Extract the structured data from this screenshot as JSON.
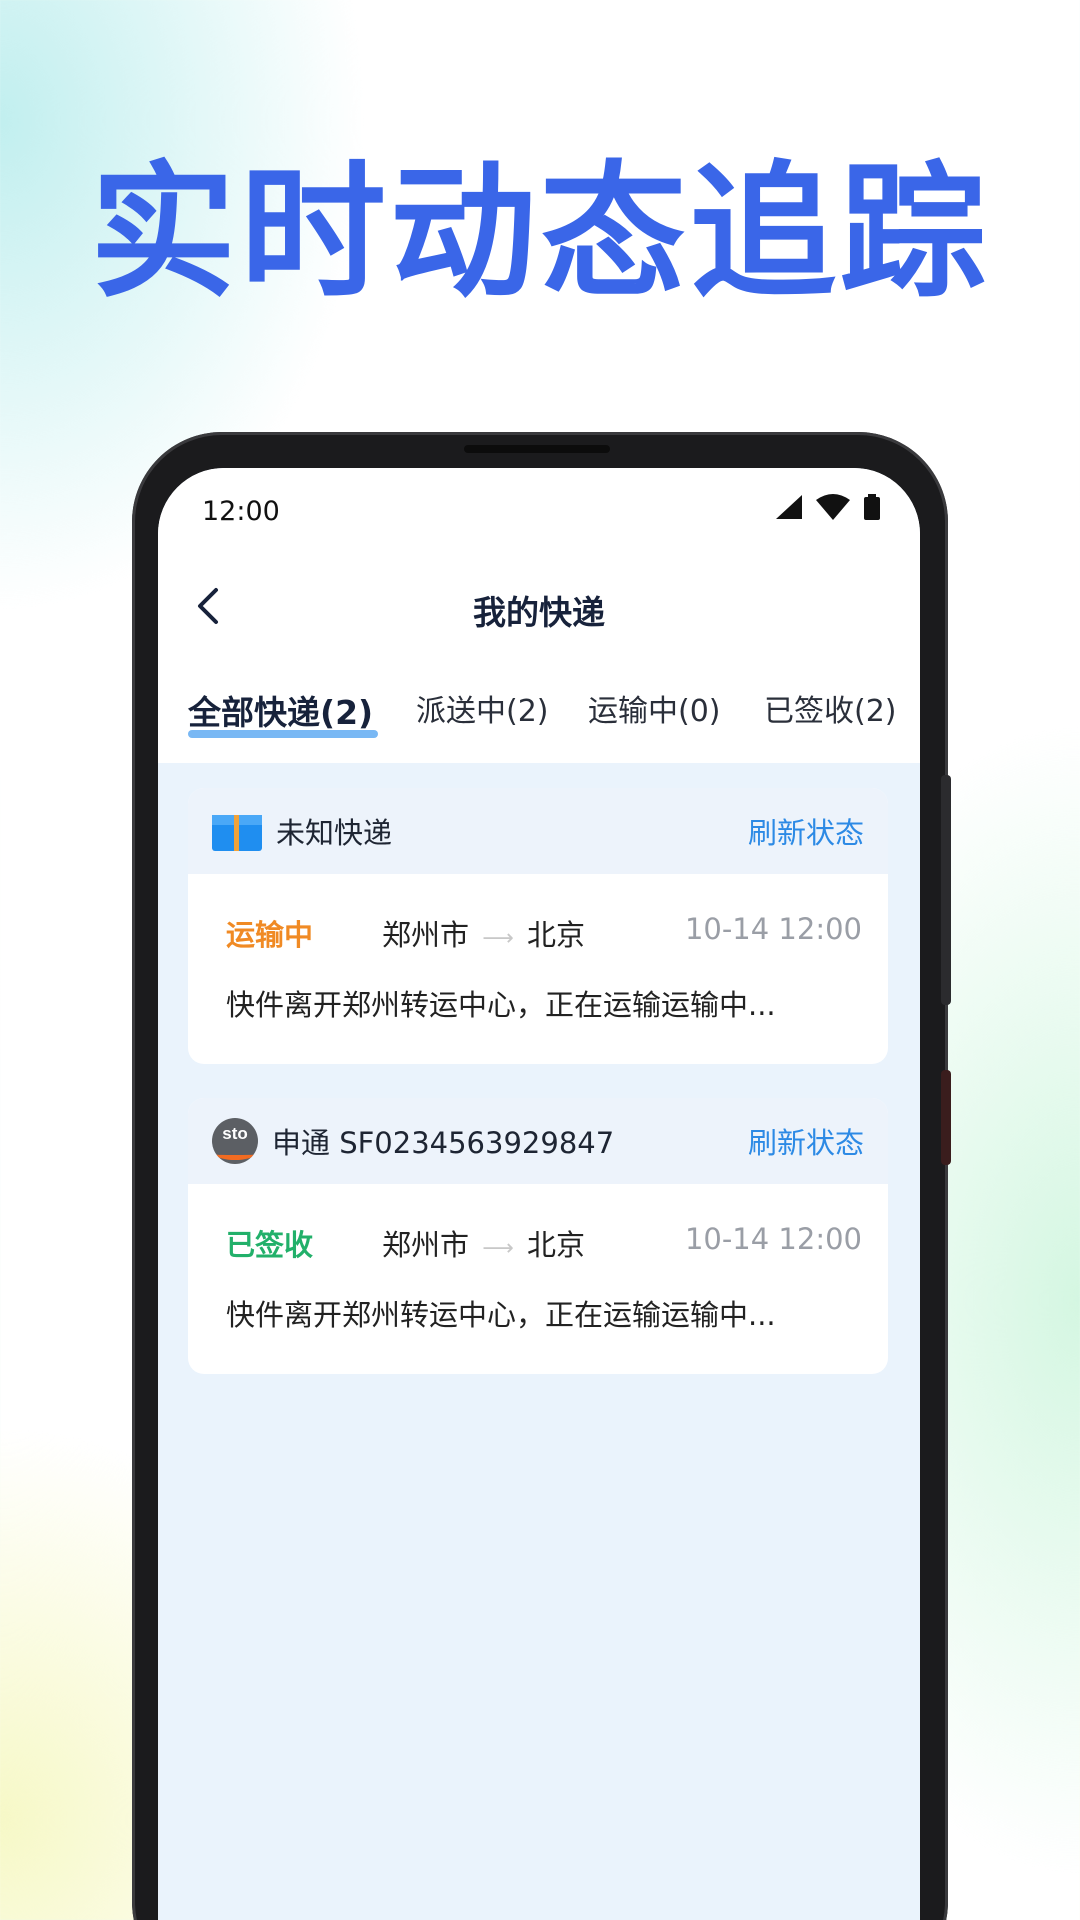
{
  "headline": "实时动态追踪",
  "status_bar": {
    "time": "12:00",
    "icons": [
      "signal-icon",
      "wifi-icon",
      "battery-icon"
    ]
  },
  "nav": {
    "back_icon": "chevron-left-icon",
    "title": "我的快递"
  },
  "tabs": [
    {
      "label": "全部快递(2)",
      "active": true
    },
    {
      "label": "派送中(2)",
      "active": false
    },
    {
      "label": "运输中(0)",
      "active": false
    },
    {
      "label": "已签收(2)",
      "active": false
    }
  ],
  "packages": [
    {
      "icon": "package-box-icon",
      "carrier": "未知快递",
      "refresh_label": "刷新状态",
      "status": "运输中",
      "status_color": "#f08a24",
      "from": "郑州市",
      "arrow": "⟶",
      "to": "北京",
      "time": "10-14 12:00",
      "description": "快件离开郑州转运中心，正在运输运输中..."
    },
    {
      "icon": "sto-logo-icon",
      "carrier": "申通 SF0234563929847",
      "refresh_label": "刷新状态",
      "status": "已签收",
      "status_color": "#22b06a",
      "from": "郑州市",
      "arrow": "⟶",
      "to": "北京",
      "time": "10-14 12:00",
      "description": "快件离开郑州转运中心，正在运输运输中..."
    }
  ],
  "colors": {
    "headline": "#3a66e8",
    "refresh_link": "#2d8ae5",
    "tab_underline": "#79b8f4"
  }
}
